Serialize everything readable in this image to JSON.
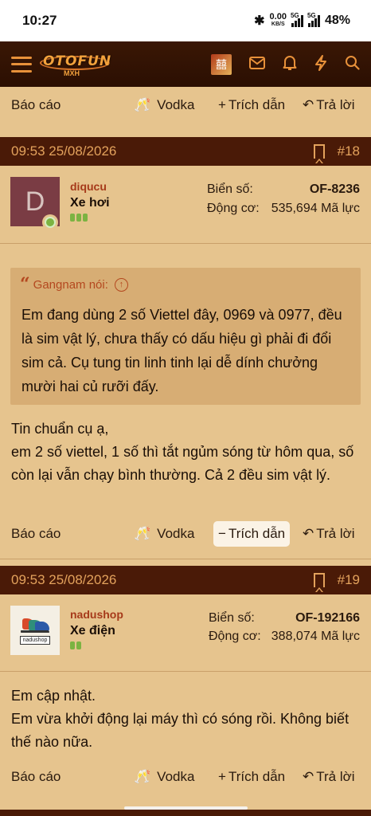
{
  "status": {
    "time": "10:27",
    "bluetooth": "✱",
    "speed_value": "0.00",
    "speed_unit": "KB/S",
    "net1": "5G",
    "net2": "5G",
    "battery": "48%"
  },
  "header": {
    "logo": "OTOFUN",
    "logo_sub": "MXH",
    "avatar_glyph": "囍",
    "icons": [
      "menu-icon",
      "mail-icon",
      "bell-icon",
      "lightning-icon",
      "search-icon"
    ]
  },
  "actions": {
    "report": "Báo cáo",
    "vodka": "Vodka",
    "quote": "Trích dẫn",
    "reply": "Trả lời",
    "plus": "+",
    "minus": "−",
    "reply_glyph": "↶",
    "glasses_glyph": "🥂"
  },
  "posts": [
    {
      "datetime": "09:53 25/08/2026",
      "number": "#18",
      "avatar_letter": "D",
      "username": "diqucu",
      "user_title": "Xe hơi",
      "plate_label": "Biển số:",
      "plate": "OF-8236",
      "engine_label": "Động cơ:",
      "engine": "535,694 Mã lực",
      "quote": {
        "author": "Gangnam nói:",
        "text": "Em đang dùng 2 số Viettel đây, 0969 và 0977, đều là sim vật lý, chưa thấy có dấu hiệu gì phải đi đổi sim cả. Cụ tung tin linh tinh lại dễ dính chưởng mười hai củ rưỡi đấy."
      },
      "lines": [
        "Tin chuẩn cụ ạ,",
        "em 2 số viettel, 1 số thì tắt ngủm sóng từ hôm qua, số còn lại vẫn chạy bình thường. Cả 2 đều sim vật lý."
      ]
    },
    {
      "datetime": "09:53 25/08/2026",
      "number": "#19",
      "avatar_label": "nadushop",
      "username": "nadushop",
      "user_title": "Xe điện",
      "plate_label": "Biển số:",
      "plate": "OF-192166",
      "engine_label": "Động cơ:",
      "engine": "388,074 Mã lực",
      "lines": [
        "Em cập nhật.",
        "Em vừa khởi động lại máy thì có sóng rồi. Không biết thế nào nữa."
      ]
    }
  ],
  "colors": {
    "page_bg": "#e6c48e",
    "header_bg": "#2b0f02",
    "post_header_bg": "#4a1a07",
    "accent": "#e8913a",
    "username": "#a63a1a",
    "online": "#7cb342"
  }
}
